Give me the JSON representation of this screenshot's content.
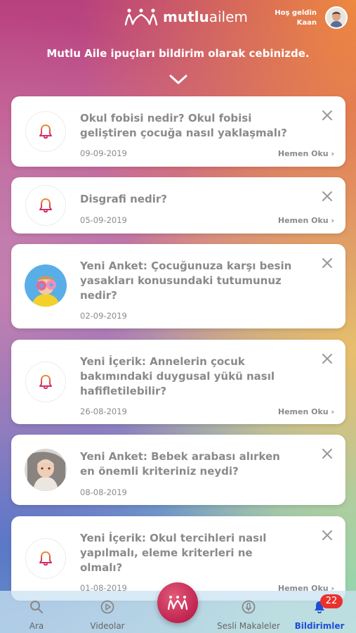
{
  "header": {
    "logo_bold": "mutlu",
    "logo_light": "ailem",
    "welcome": "Hoş geldin",
    "user_name": "Kaan",
    "tagline": "Mutlu Aile ipuçları bildirim olarak cebinizde."
  },
  "notifications": [
    {
      "title": "Okul fobisi nedir? Okul fobisi geliştiren çocuğa nasıl yaklaşmalı?",
      "date": "09-09-2019",
      "action": "Hemen Oku ›",
      "icon": "bell-icon"
    },
    {
      "title": "Disgrafi nedir?",
      "date": "05-09-2019",
      "action": "Hemen Oku ›",
      "icon": "bell-icon"
    },
    {
      "title": "Yeni Anket: Çocuğunuza karşı besin yasakları konusundaki tutumunuz nedir?",
      "date": "02-09-2019",
      "action": "",
      "icon": "child-donut-photo"
    },
    {
      "title": "Yeni İçerik: Annelerin çocuk bakımındaki duygusal yükü nasıl hafifletilebilir?",
      "date": "26-08-2019",
      "action": "Hemen Oku ›",
      "icon": "bell-icon"
    },
    {
      "title": "Yeni Anket: Bebek arabası alırken en önemli kriteriniz neydi?",
      "date": "08-08-2019",
      "action": "",
      "icon": "baby-stroller-photo"
    },
    {
      "title": "Yeni İçerik: Okul tercihleri nasıl yapılmalı, eleme kriterleri ne olmalı?",
      "date": "01-08-2019",
      "action": "Hemen Oku ›",
      "icon": "bell-icon"
    }
  ],
  "nav": {
    "search": "Ara",
    "videos": "Videolar",
    "audio": "Sesli Makaleler",
    "notifications": "Bildirimler",
    "badge_count": "22"
  },
  "colors": {
    "active_nav": "#1d4fd8",
    "badge": "#e8322f",
    "bell_orange": "#f07a2a",
    "bell_pink": "#d2276a"
  }
}
